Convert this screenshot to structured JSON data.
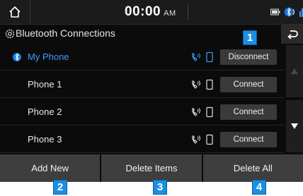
{
  "status": {
    "time": "00:00",
    "ampm": "AM"
  },
  "header": {
    "title": "Bluetooth Connections"
  },
  "devices": [
    {
      "name": "My Phone",
      "action": "Disconnect",
      "connected": true
    },
    {
      "name": "Phone 1",
      "action": "Connect",
      "connected": false
    },
    {
      "name": "Phone 2",
      "action": "Connect",
      "connected": false
    },
    {
      "name": "Phone 3",
      "action": "Connect",
      "connected": false
    }
  ],
  "bottom": {
    "add_new": "Add New",
    "delete_items": "Delete Items",
    "delete_all": "Delete All"
  },
  "callouts": [
    "1",
    "2",
    "3",
    "4"
  ],
  "colors": {
    "accent": "#3b9bff",
    "badge": "#1a8fe3"
  }
}
